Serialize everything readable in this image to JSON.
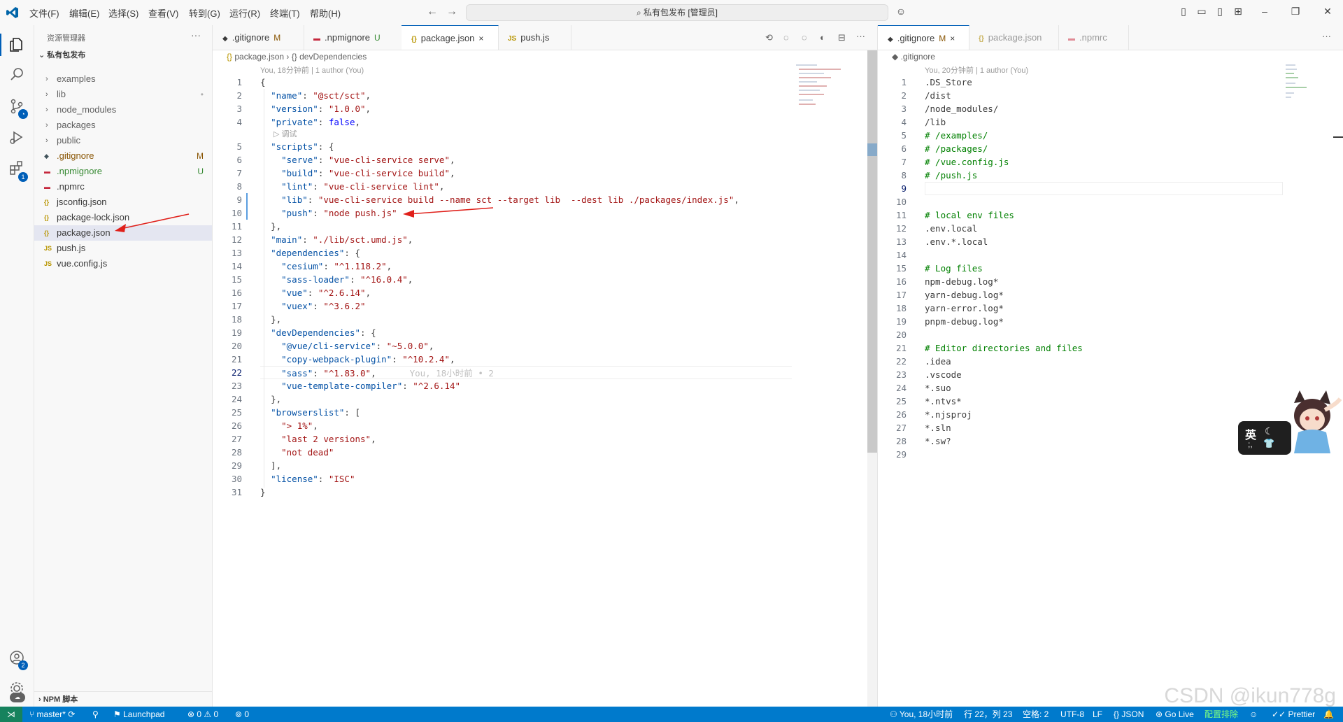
{
  "menu": [
    "文件(F)",
    "编辑(E)",
    "选择(S)",
    "查看(V)",
    "转到(G)",
    "运行(R)",
    "终端(T)",
    "帮助(H)"
  ],
  "command_center": "私有包发布 [管理员]",
  "sidebar": {
    "title": "资源管理器",
    "folder": "私有包发布",
    "items": [
      {
        "label": "examples",
        "kind": "folder"
      },
      {
        "label": "lib",
        "kind": "folder",
        "status": "•"
      },
      {
        "label": "node_modules",
        "kind": "folder"
      },
      {
        "label": "packages",
        "kind": "folder"
      },
      {
        "label": "public",
        "kind": "folder"
      },
      {
        "label": ".gitignore",
        "kind": "file",
        "status": "M",
        "color": "#895503"
      },
      {
        "label": ".npmignore",
        "kind": "file",
        "status": "U",
        "color": "#388a34"
      },
      {
        "label": ".npmrc",
        "kind": "file"
      },
      {
        "label": "jsconfig.json",
        "kind": "file"
      },
      {
        "label": "package-lock.json",
        "kind": "file"
      },
      {
        "label": "package.json",
        "kind": "file",
        "selected": true
      },
      {
        "label": "push.js",
        "kind": "file"
      },
      {
        "label": "vue.config.js",
        "kind": "file"
      }
    ],
    "npm_section": "NPM 脚本"
  },
  "left_group": {
    "tabs": [
      {
        "label": ".gitignore",
        "mark": "M"
      },
      {
        "label": ".npmignore",
        "mark": "U"
      },
      {
        "label": "package.json",
        "mark": "×",
        "active": true
      },
      {
        "label": "push.js",
        "mark": ""
      }
    ],
    "breadcrumb": {
      "file": "package.json",
      "path": "devDependencies"
    },
    "blame": "You, 18分钟前 | 1 author (You)",
    "codelens_debug": "调试",
    "inline_blame": "You, 18小时前 • 2",
    "lines": [
      "{",
      "  \"name\": \"@sct/sct\",",
      "  \"version\": \"1.0.0\",",
      "  \"private\": false,",
      "  \"scripts\": {",
      "    \"serve\": \"vue-cli-service serve\",",
      "    \"build\": \"vue-cli-service build\",",
      "    \"lint\": \"vue-cli-service lint\",",
      "    \"lib\": \"vue-cli-service build --name sct --target lib  --dest lib ./packages/index.js\",",
      "    \"push\": \"node push.js\"",
      "  },",
      "  \"main\": \"./lib/sct.umd.js\",",
      "  \"dependencies\": {",
      "    \"cesium\": \"^1.118.2\",",
      "    \"sass-loader\": \"^16.0.4\",",
      "    \"vue\": \"^2.6.14\",",
      "    \"vuex\": \"^3.6.2\"",
      "  },",
      "  \"devDependencies\": {",
      "    \"@vue/cli-service\": \"~5.0.0\",",
      "    \"copy-webpack-plugin\": \"^10.2.4\",",
      "    \"sass\": \"^1.83.0\",",
      "    \"vue-template-compiler\": \"^2.6.14\"",
      "  },",
      "  \"browserslist\": [",
      "    \"> 1%\",",
      "    \"last 2 versions\",",
      "    \"not dead\"",
      "  ],",
      "  \"license\": \"ISC\"",
      "}"
    ]
  },
  "right_group": {
    "tabs": [
      {
        "label": ".gitignore",
        "mark": "M",
        "active": true
      },
      {
        "label": "package.json",
        "mark": ""
      },
      {
        "label": ".npmrc",
        "mark": ""
      }
    ],
    "breadcrumb": ".gitignore",
    "blame": "You, 20分钟前 | 1 author (You)",
    "lines": [
      ".DS_Store",
      "/dist",
      "/node_modules/",
      "/lib",
      "# /examples/",
      "# /packages/",
      "# /vue.config.js",
      "# /push.js",
      "",
      "",
      "# local env files",
      ".env.local",
      ".env.*.local",
      "",
      "# Log files",
      "npm-debug.log*",
      "yarn-debug.log*",
      "yarn-error.log*",
      "pnpm-debug.log*",
      "",
      "# Editor directories and files",
      ".idea",
      ".vscode",
      "*.suo",
      "*.ntvs*",
      "*.njsproj",
      "*.sln",
      "*.sw?",
      ""
    ]
  },
  "statusbar": {
    "branch": "master*",
    "launchpad": "Launchpad",
    "problems": "0",
    "warnings": "0",
    "ports": "0",
    "blame": "You, 18小时前",
    "position": "行 22，列 23",
    "spaces": "空格: 2",
    "encoding": "UTF-8",
    "eol": "LF",
    "language": "JSON",
    "golive": "Go Live",
    "config": "配置排除",
    "prettier": "Prettier"
  },
  "ime_label": "英",
  "watermark": "CSDN @ikun778g",
  "accent_color": "#005fb8",
  "status_color": "#007acc"
}
